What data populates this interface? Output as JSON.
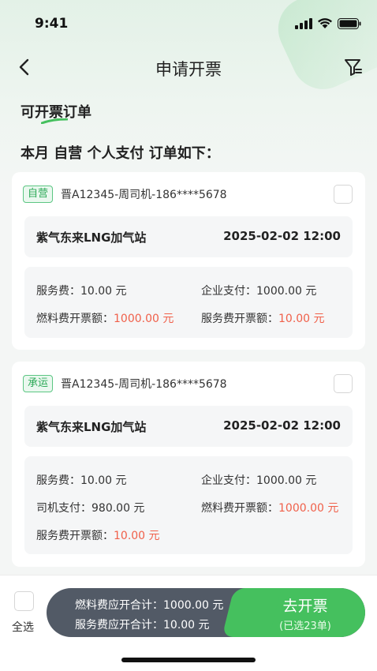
{
  "status_bar": {
    "time": "9:41"
  },
  "nav": {
    "title": "申请开票"
  },
  "section_title": "可开票订单",
  "summary_text": "本月 自营 个人支付 订单如下：",
  "orders": [
    {
      "tag": "自营",
      "driver": "晋A12345-周司机-186****5678",
      "station": "紫气东来LNG加气站",
      "time": "2025-02-02 12:00",
      "service_fee": "服务费：10.00 元",
      "company_pay": "企业支付：1000.00 元",
      "fuel_invoice_label": "燃料费开票额：",
      "fuel_invoice_value": "1000.00 元",
      "service_invoice_label": "服务费开票额：",
      "service_invoice_value": "10.00 元"
    },
    {
      "tag": "承运",
      "driver": "晋A12345-周司机-186****5678",
      "station": "紫气东来LNG加气站",
      "time": "2025-02-02 12:00",
      "service_fee": "服务费：10.00 元",
      "company_pay": "企业支付：1000.00 元",
      "driver_pay": "司机支付：980.00 元",
      "fuel_invoice_label": "燃料费开票额：",
      "fuel_invoice_value": "1000.00 元",
      "service_invoice_label": "服务费开票额：",
      "service_invoice_value": "10.00 元"
    }
  ],
  "bottom": {
    "select_all": "全选",
    "fuel_total": "燃料费应开合计：1000.00 元",
    "service_total": "服务费应开合计：10.00 元",
    "invoice_button": "去开票",
    "selected_count": "(已选23单)"
  },
  "colors": {
    "accent": "#45c05e",
    "red": "#f0604a",
    "pill": "#525a66"
  }
}
